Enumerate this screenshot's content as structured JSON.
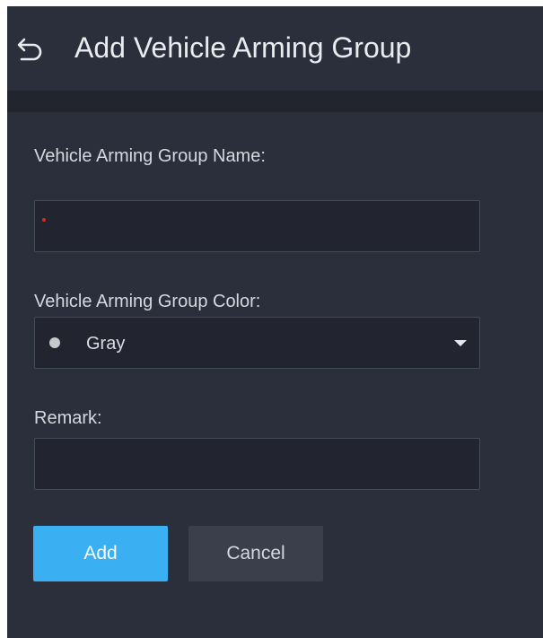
{
  "header": {
    "title": "Add Vehicle Arming Group",
    "back_icon": "back-arrow-icon"
  },
  "form": {
    "name": {
      "label": "Vehicle Arming Group Name:",
      "value": "",
      "required": true
    },
    "color": {
      "label": "Vehicle Arming Group Color:",
      "selected": "Gray",
      "swatch_color": "#c8c9cc",
      "icon": "chevron-down-icon"
    },
    "remark": {
      "label": "Remark:",
      "value": ""
    }
  },
  "actions": {
    "add_label": "Add",
    "cancel_label": "Cancel"
  },
  "colors": {
    "panel_bg": "#2b2f3c",
    "input_bg": "#22252f",
    "accent": "#3ab0f3",
    "required": "#e0241b"
  }
}
